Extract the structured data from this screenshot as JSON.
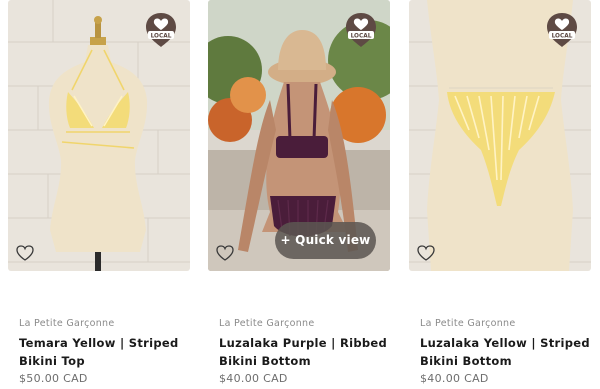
{
  "badge": {
    "label": "LOCAL",
    "icon": "heart-location-pin-icon"
  },
  "quick_view_label": "+ Quick view",
  "products": [
    {
      "vendor": "La Petite Garçonne",
      "title": "Temara Yellow | Striped Bikini Top",
      "price": "$50.00 CAD"
    },
    {
      "vendor": "La Petite Garçonne",
      "title": "Luzalaka Purple | Ribbed Bikini Bottom",
      "price": "$40.00 CAD"
    },
    {
      "vendor": "La Petite Garçonne",
      "title": "Luzalaka Yellow | Striped Bikini Bottom",
      "price": "$40.00 CAD"
    }
  ],
  "colors": {
    "title": "#1a1a1a",
    "vendor": "#8a8a8a",
    "price": "#6e6e6e",
    "badge": "#5e4a44",
    "quick_view_bg": "#5c5652"
  }
}
